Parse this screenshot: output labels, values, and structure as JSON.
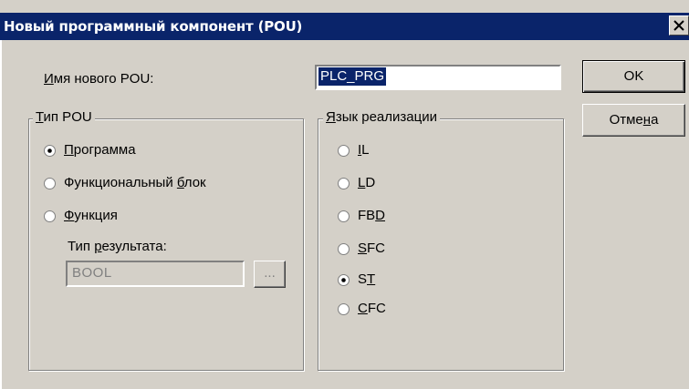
{
  "dialog": {
    "title": "Новый программный компонент (POU)"
  },
  "name_field": {
    "label_u": "И",
    "label_rest": "мя нового POU:",
    "value": "PLC_PRG"
  },
  "buttons": {
    "ok": "OK",
    "cancel_pre": "Отме",
    "cancel_u": "н",
    "cancel_post": "а"
  },
  "pou_type": {
    "title_u": "Т",
    "title_rest": "ип POU",
    "options": [
      {
        "pre": "",
        "u": "П",
        "post": "рограмма",
        "selected": true
      },
      {
        "pre": "Функциональный ",
        "u": "б",
        "post": "лок",
        "selected": false
      },
      {
        "pre": "",
        "u": "Ф",
        "post": "ункция",
        "selected": false
      }
    ],
    "result_type": {
      "label_pre": "Тип ",
      "label_u": "р",
      "label_post": "езультата:",
      "value": "BOOL",
      "browse_label": "..."
    }
  },
  "language": {
    "title_u": "Я",
    "title_rest": "зык реализации",
    "options": [
      {
        "pre": "",
        "u": "I",
        "post": "L",
        "selected": false
      },
      {
        "pre": "",
        "u": "L",
        "post": "D",
        "selected": false
      },
      {
        "pre": "FB",
        "u": "D",
        "post": "",
        "selected": false
      },
      {
        "pre": "",
        "u": "S",
        "post": "FC",
        "selected": false
      },
      {
        "pre": "S",
        "u": "T",
        "post": "",
        "selected": true
      },
      {
        "pre": "",
        "u": "C",
        "post": "FC",
        "selected": false
      }
    ]
  }
}
